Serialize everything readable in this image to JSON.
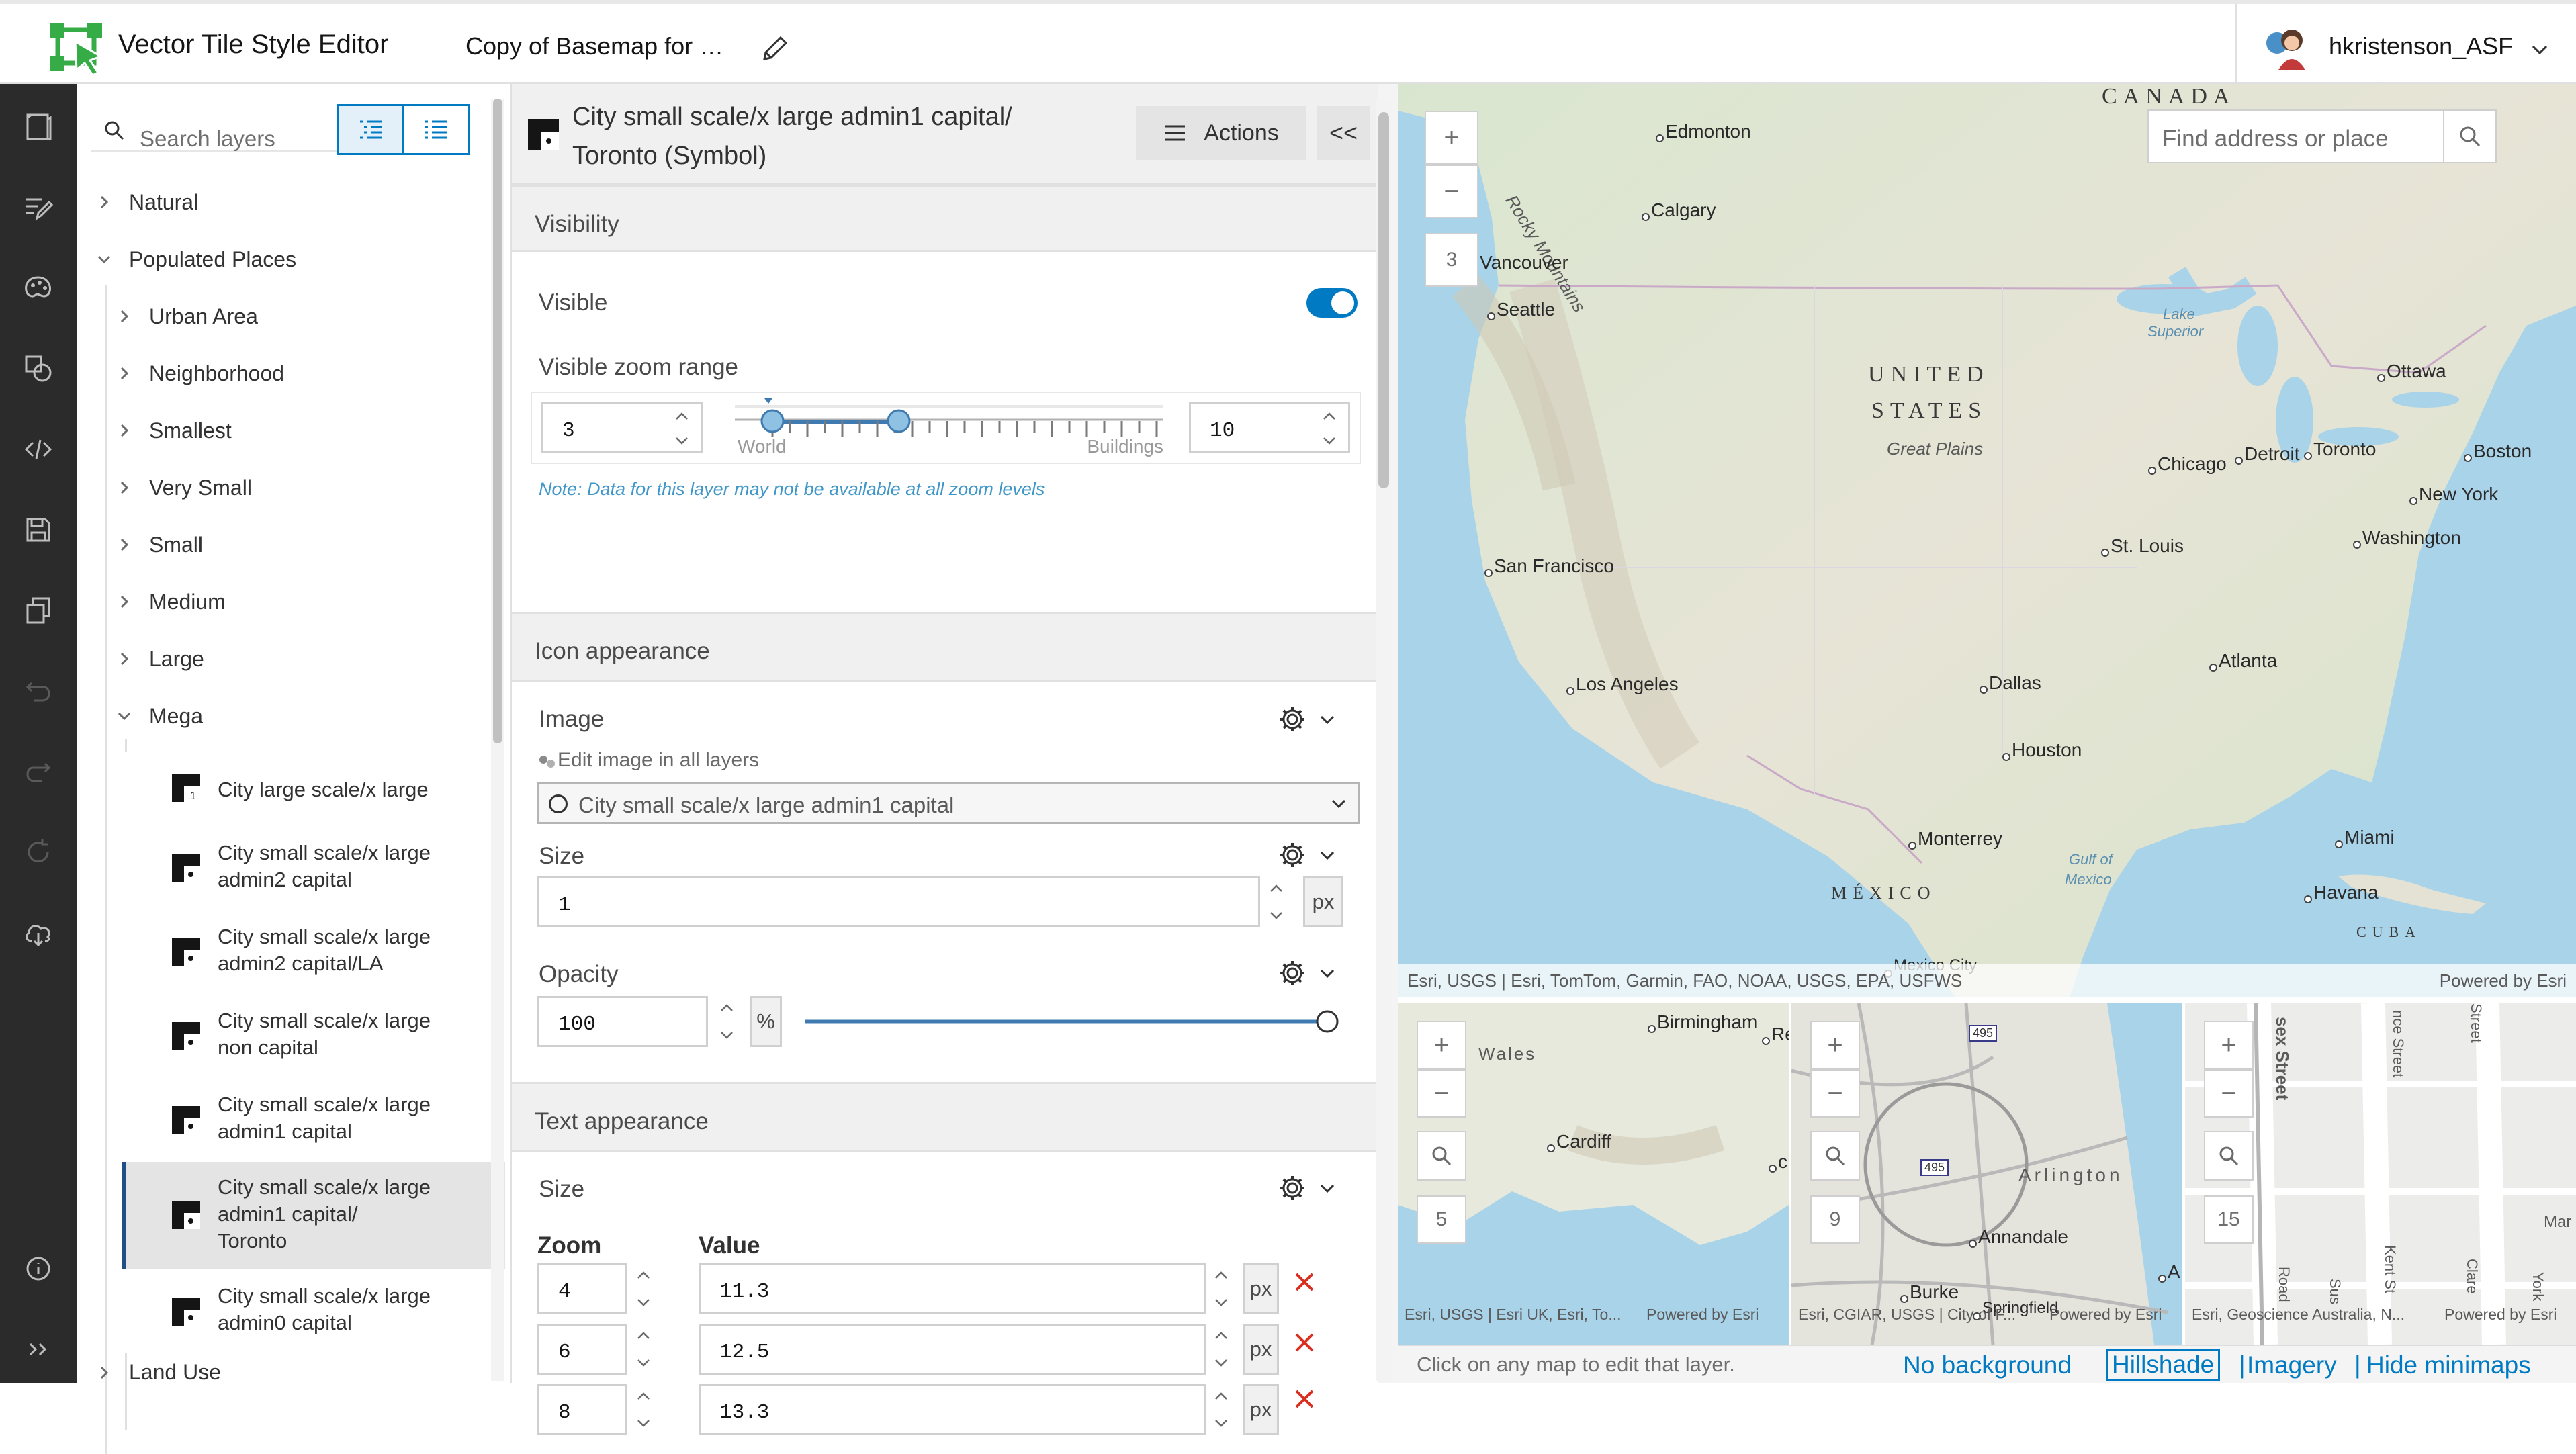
{
  "header": {
    "app_title": "Vector Tile Style Editor",
    "map_title": "Copy of Basemap for …",
    "username": "hkristenson_ASF"
  },
  "rail_icons": [
    "layers-icon",
    "quick-edit-icon",
    "palette-icon",
    "shapes-icon",
    "code-icon",
    "save-icon",
    "copy-icon",
    "undo-icon",
    "redo-icon",
    "reset-icon",
    "cloud-download-icon",
    "info-icon",
    "expand-icon"
  ],
  "layers": {
    "search_placeholder": "Search layers",
    "items": {
      "natural": "Natural",
      "populated": "Populated Places",
      "urban": "Urban Area",
      "neighborhood": "Neighborhood",
      "smallest": "Smallest",
      "very_small": "Very Small",
      "small": "Small",
      "medium": "Medium",
      "large": "Large",
      "mega": "Mega",
      "land_use": "Land Use"
    },
    "sublayers": [
      {
        "l1": "City large scale/x large",
        "l2": "",
        "l3": ""
      },
      {
        "l1": "City small scale/x large",
        "l2": "admin2 capital",
        "l3": ""
      },
      {
        "l1": "City small scale/x large",
        "l2": "admin2 capital/LA",
        "l3": ""
      },
      {
        "l1": "City small scale/x large",
        "l2": "non capital",
        "l3": ""
      },
      {
        "l1": "City small scale/x large",
        "l2": "admin1 capital",
        "l3": ""
      },
      {
        "l1": "City small scale/x large",
        "l2": "admin1 capital/",
        "l3": "Toronto"
      },
      {
        "l1": "City small scale/x large",
        "l2": "admin0 capital",
        "l3": ""
      }
    ]
  },
  "panel": {
    "title_line1": "City small scale/x large admin1 capital/",
    "title_line2": "Toronto (Symbol)",
    "actions_label": "Actions",
    "collapse_label": "<<",
    "visibility": {
      "header": "Visibility",
      "visible_label": "Visible",
      "visible_on": true,
      "zoom_range_label": "Visible zoom range",
      "min_zoom": "3",
      "max_zoom": "10",
      "world_label": "World",
      "buildings_label": "Buildings",
      "note": "Note: Data for this layer may not be available at all zoom levels"
    },
    "icon": {
      "header": "Icon appearance",
      "image_label": "Image",
      "edit_all_label": "Edit image in all layers",
      "image_value": "City small scale/x large admin1 capital",
      "size_label": "Size",
      "size_value": "1",
      "size_unit": "px",
      "opacity_label": "Opacity",
      "opacity_value": "100",
      "opacity_unit": "%",
      "opacity_level": 1.0
    },
    "text": {
      "header": "Text appearance",
      "size_label": "Size",
      "zoom_col": "Zoom",
      "value_col": "Value",
      "unit": "px",
      "rows": [
        {
          "zoom": "4",
          "value": "11.3"
        },
        {
          "zoom": "6",
          "value": "12.5"
        },
        {
          "zoom": "8",
          "value": "13.3"
        }
      ]
    }
  },
  "map": {
    "search_placeholder": "Find address or place",
    "zoom_level": "3",
    "attribution_left": "Esri, USGS | Esri, TomTom, Garmin, FAO, NOAA, USGS, EPA, USFWS",
    "attribution_right": "Powered by Esri",
    "countries": {
      "canada": "CANADA",
      "us1": "UNITED",
      "us2": "STATES",
      "mexico": "MÉXICO",
      "cuba": "CUBA"
    },
    "features": {
      "rocky": "Rocky Mountains",
      "plains": "Great Plains",
      "superior1": "Lake",
      "superior2": "Superior",
      "gulf1": "Gulf of",
      "gulf2": "Mexico"
    },
    "cities": {
      "edmonton": "Edmonton",
      "calgary": "Calgary",
      "vancouver": "Vancouver",
      "seattle": "Seattle",
      "ottawa": "Ottawa",
      "chicago": "Chicago",
      "detroit": "Detroit",
      "toronto": "Toronto",
      "boston": "Boston",
      "newyork": "New York",
      "washington": "Washington",
      "stlouis": "St. Louis",
      "sanfrancisco": "San Francisco",
      "losangeles": "Los Angeles",
      "dallas": "Dallas",
      "atlanta": "Atlanta",
      "houston": "Houston",
      "monterrey": "Monterrey",
      "miami": "Miami",
      "havana": "Havana",
      "mexicocity": "Mexico City"
    }
  },
  "minimaps": [
    {
      "zoom": "5",
      "attrib": "Esri, USGS | Esri UK, Esri, To...",
      "powered": "Powered by Esri",
      "labels": {
        "birmingham": "Birmingham",
        "wales": "Wales",
        "cardiff": "Cardiff",
        "re": "Re",
        "c": "c"
      }
    },
    {
      "zoom": "9",
      "attrib": "Esri, CGIAR, USGS | City of F...",
      "powered": "Powered by Esri",
      "labels": {
        "arlington": "Arlington",
        "annandale": "Annandale",
        "burke": "Burke",
        "springfield": "Springfield",
        "i495a": "495",
        "i495b": "495",
        "a": "A"
      }
    },
    {
      "zoom": "15",
      "attrib": "Esri, Geoscience Australia, N...",
      "powered": "Powered by Esri",
      "labels": {
        "sex": "sex Street",
        "nce": "nce Street",
        "s2": "Street",
        "kent": "Kent St",
        "clar": "Clare",
        "york": "York",
        "mar": "Mar",
        "road": "Road",
        "sus": "Sus"
      }
    }
  ],
  "minibar": {
    "hint": "Click on any map to edit that layer.",
    "no_background": "No background",
    "hillshade": "Hillshade",
    "imagery": "Imagery",
    "hide": "Hide minimaps",
    "sep": "|"
  },
  "colors": {
    "accent": "#007ac2",
    "rail": "#2b2b2b",
    "logo": "#35ac46",
    "delete": "#d83020"
  }
}
